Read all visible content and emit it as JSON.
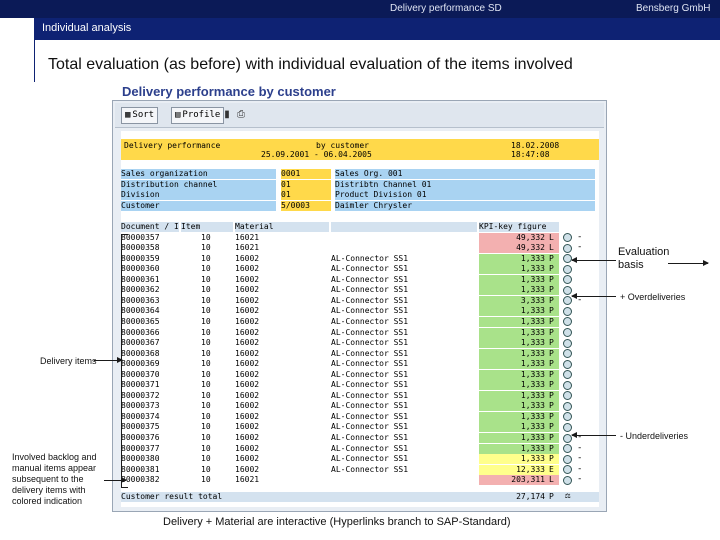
{
  "slide": {
    "header_center": "Delivery performance SD",
    "header_right": "Bensberg GmbH",
    "section": "Individual analysis",
    "headline": "Total evaluation (as before) with individual evaluation of the items involved",
    "caption": "Delivery + Material are interactive (Hyperlinks branch to SAP-Standard)"
  },
  "screen": {
    "title": "Delivery performance by customer",
    "toolbar": {
      "sort": "Sort",
      "profile": "Profile",
      "chart_icon": "chart-icon",
      "print_icon": "print-icon"
    },
    "report_header": {
      "left": "Delivery performance",
      "mid1": "by customer",
      "mid2": "25.09.2001 - 06.04.2005",
      "right": "18.02.2008 18:47:08"
    },
    "selection": [
      {
        "label": "Sales organization",
        "code": "0001",
        "text": "Sales Org. 001"
      },
      {
        "label": "Distribution channel",
        "code": "01",
        "text": "Distribtn Channel 01"
      },
      {
        "label": "Division",
        "code": "01",
        "text": "Product Division 01"
      },
      {
        "label": "Customer",
        "code": "5/0003",
        "text": "Daimler Chrysler"
      }
    ],
    "columns": [
      "Document / Item",
      "Item",
      "Material",
      "",
      "KPI-key figure"
    ],
    "rows": [
      {
        "doc": "80000357",
        "item": "10",
        "mat": "16021",
        "desc": "",
        "kf": "49,332",
        "u": "L",
        "status": "red",
        "mark": "-"
      },
      {
        "doc": "80000358",
        "item": "10",
        "mat": "16021",
        "desc": "",
        "kf": "49,332",
        "u": "L",
        "status": "red",
        "mark": "-"
      },
      {
        "doc": "80000359",
        "item": "10",
        "mat": "16002",
        "desc": "AL-Connector SS1",
        "kf": "1,333",
        "u": "P",
        "status": "green",
        "mark": ""
      },
      {
        "doc": "80000360",
        "item": "10",
        "mat": "16002",
        "desc": "AL-Connector SS1",
        "kf": "1,333",
        "u": "P",
        "status": "green",
        "mark": ""
      },
      {
        "doc": "80000361",
        "item": "10",
        "mat": "16002",
        "desc": "AL-Connector SS1",
        "kf": "1,333",
        "u": "P",
        "status": "green",
        "mark": ""
      },
      {
        "doc": "80000362",
        "item": "10",
        "mat": "16002",
        "desc": "AL-Connector SS1",
        "kf": "1,333",
        "u": "P",
        "status": "green",
        "mark": ""
      },
      {
        "doc": "80000363",
        "item": "10",
        "mat": "16002",
        "desc": "AL-Connector SS1",
        "kf": "3,333",
        "u": "P",
        "status": "green",
        "mark": "-"
      },
      {
        "doc": "80000364",
        "item": "10",
        "mat": "16002",
        "desc": "AL-Connector SS1",
        "kf": "1,333",
        "u": "P",
        "status": "green",
        "mark": ""
      },
      {
        "doc": "80000365",
        "item": "10",
        "mat": "16002",
        "desc": "AL-Connector SS1",
        "kf": "1,333",
        "u": "P",
        "status": "green",
        "mark": ""
      },
      {
        "doc": "80000366",
        "item": "10",
        "mat": "16002",
        "desc": "AL-Connector SS1",
        "kf": "1,333",
        "u": "P",
        "status": "green",
        "mark": ""
      },
      {
        "doc": "80000367",
        "item": "10",
        "mat": "16002",
        "desc": "AL-Connector SS1",
        "kf": "1,333",
        "u": "P",
        "status": "green",
        "mark": ""
      },
      {
        "doc": "80000368",
        "item": "10",
        "mat": "16002",
        "desc": "AL-Connector SS1",
        "kf": "1,333",
        "u": "P",
        "status": "green",
        "mark": ""
      },
      {
        "doc": "80000369",
        "item": "10",
        "mat": "16002",
        "desc": "AL-Connector SS1",
        "kf": "1,333",
        "u": "P",
        "status": "green",
        "mark": ""
      },
      {
        "doc": "80000370",
        "item": "10",
        "mat": "16002",
        "desc": "AL-Connector SS1",
        "kf": "1,333",
        "u": "P",
        "status": "green",
        "mark": ""
      },
      {
        "doc": "80000371",
        "item": "10",
        "mat": "16002",
        "desc": "AL-Connector SS1",
        "kf": "1,333",
        "u": "P",
        "status": "green",
        "mark": ""
      },
      {
        "doc": "80000372",
        "item": "10",
        "mat": "16002",
        "desc": "AL-Connector SS1",
        "kf": "1,333",
        "u": "P",
        "status": "green",
        "mark": ""
      },
      {
        "doc": "80000373",
        "item": "10",
        "mat": "16002",
        "desc": "AL-Connector SS1",
        "kf": "1,333",
        "u": "P",
        "status": "green",
        "mark": ""
      },
      {
        "doc": "80000374",
        "item": "10",
        "mat": "16002",
        "desc": "AL-Connector SS1",
        "kf": "1,333",
        "u": "P",
        "status": "green",
        "mark": ""
      },
      {
        "doc": "80000375",
        "item": "10",
        "mat": "16002",
        "desc": "AL-Connector SS1",
        "kf": "1,333",
        "u": "P",
        "status": "green",
        "mark": ""
      },
      {
        "doc": "80000376",
        "item": "10",
        "mat": "16002",
        "desc": "AL-Connector SS1",
        "kf": "1,333",
        "u": "P",
        "status": "green",
        "mark": "-"
      },
      {
        "doc": "80000377",
        "item": "10",
        "mat": "16002",
        "desc": "AL-Connector SS1",
        "kf": "1,333",
        "u": "P",
        "status": "green",
        "mark": "-"
      },
      {
        "doc": "80000380",
        "item": "10",
        "mat": "16002",
        "desc": "AL-Connector SS1",
        "kf": "1,333",
        "u": "P",
        "status": "yellow",
        "mark": "-"
      },
      {
        "doc": "80000381",
        "item": "10",
        "mat": "16002",
        "desc": "AL-Connector SS1",
        "kf": "12,333",
        "u": "E",
        "status": "yellow",
        "mark": "-"
      },
      {
        "doc": "80000382",
        "item": "10",
        "mat": "16021",
        "desc": "",
        "kf": "203,311",
        "u": "L",
        "status": "red",
        "mark": "-"
      }
    ],
    "total": {
      "label": "Customer result total",
      "kf": "27,174",
      "u": "P"
    },
    "colors": {
      "red": "#f3b0b0",
      "green": "#a9e28a",
      "yellow": "#ffff8c",
      "header_yellow": "#ffd94a",
      "label_blue": "#a9d3f2"
    }
  },
  "annotations": {
    "evaluation_basis": "Evaluation basis",
    "overdeliveries": "+ Overdeliveries",
    "underdeliveries": "- Underdeliveries",
    "delivery_items": "Delivery items",
    "backlog": "Involved backlog and manual items appear subsequent to the delivery items with colored indication"
  }
}
